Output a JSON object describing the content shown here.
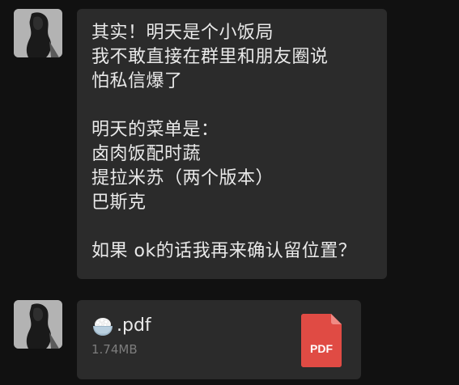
{
  "message": {
    "lines": [
      "其实！明天是个小饭局",
      "我不敢直接在群里和朋友圈说",
      "怕私信爆了",
      "",
      "明天的菜单是：",
      "卤肉饭配时蔬",
      "提拉米苏（两个版本）",
      "巴斯克",
      "",
      "如果 ok的话我再来确认留位置？"
    ]
  },
  "file": {
    "name": ".pdf",
    "size": "1.74MB",
    "type_label": "PDF",
    "icon": "rice-bowl-emoji",
    "type_icon": "pdf-file-icon",
    "type_color": "#e04b44"
  },
  "colors": {
    "background": "#111111",
    "bubble": "#2b2b2b",
    "text": "#e9e9e9",
    "muted": "#7d7d7d"
  }
}
